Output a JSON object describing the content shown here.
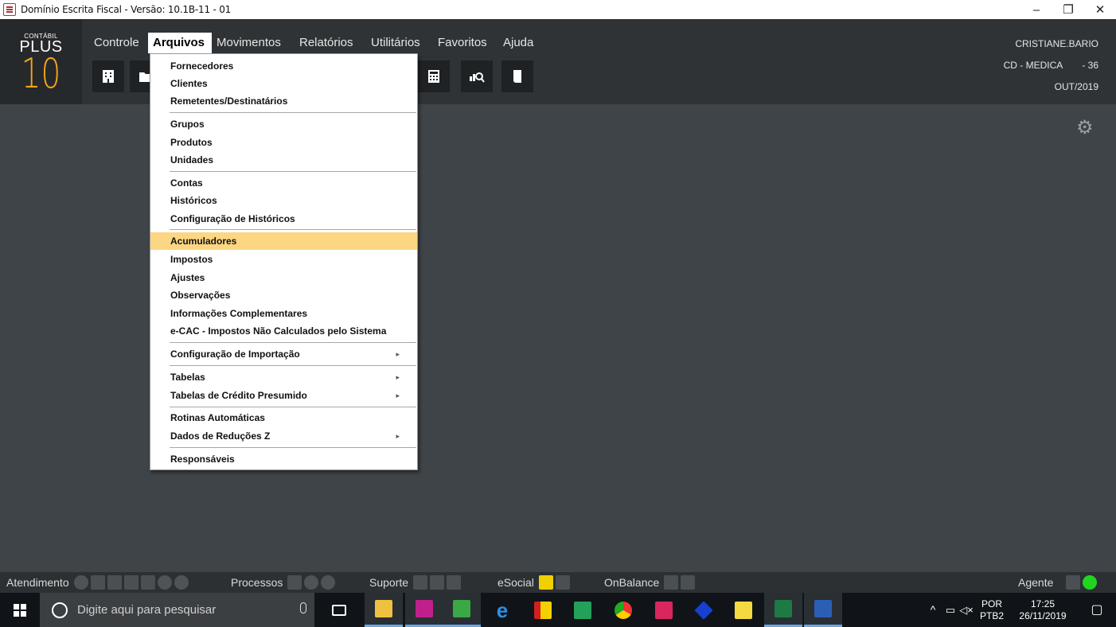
{
  "window": {
    "title": "Domínio Escrita Fiscal  - Versão: 10.1B-11 - 01",
    "controls": [
      "–",
      "❐",
      "✕"
    ]
  },
  "logo": {
    "small": "CONTÁBIL",
    "plus": "PLUS",
    "ten": "10"
  },
  "menubar": [
    {
      "label": "Controle"
    },
    {
      "label": "Arquivos",
      "active": true
    },
    {
      "label": "Movimentos"
    },
    {
      "label": "Relatórios"
    },
    {
      "label": "Utilitários"
    },
    {
      "label": "Favoritos"
    },
    {
      "label": "Ajuda"
    }
  ],
  "user": {
    "name": "CRISTIANE.BARIO",
    "company": "CD - MEDICA",
    "company_code": "- 36",
    "period": "OUT/2019"
  },
  "dropdown": {
    "items": [
      {
        "label": "Fornecedores"
      },
      {
        "label": "Clientes"
      },
      {
        "label": "Remetentes/Destinatários"
      },
      {
        "label": "Grupos"
      },
      {
        "label": "Produtos"
      },
      {
        "label": "Unidades"
      },
      {
        "label": "Contas"
      },
      {
        "label": "Históricos"
      },
      {
        "label": "Configuração de Históricos"
      },
      {
        "label": "Acumuladores",
        "highlighted": true
      },
      {
        "label": "Impostos"
      },
      {
        "label": "Ajustes"
      },
      {
        "label": "Observações"
      },
      {
        "label": "Informações Complementares"
      },
      {
        "label": "e-CAC - Impostos Não Calculados pelo Sistema"
      },
      {
        "label": "Configuração de Importação",
        "submenu": true
      },
      {
        "label": "Tabelas",
        "submenu": true
      },
      {
        "label": "Tabelas de Crédito Presumido",
        "submenu": true
      },
      {
        "label": "Rotinas Automáticas"
      },
      {
        "label": "Dados de Reduções Z",
        "submenu": true
      },
      {
        "label": "Responsáveis"
      }
    ],
    "submenu_arrow": "▸"
  },
  "status": {
    "atendimento": "Atendimento",
    "processos": "Processos",
    "suporte": "Suporte",
    "esocial": "eSocial",
    "onbalance": "OnBalance",
    "agente": "Agente"
  },
  "taskbar": {
    "search_placeholder": "Digite aqui para pesquisar",
    "lang_top": "POR",
    "lang_bottom": "PTB2",
    "time": "17:25",
    "date": "26/11/2019"
  },
  "colors": {
    "background": "#3f4448",
    "header": "#2f3336",
    "highlight": "#fcd682",
    "logo_accent": "#f2a51a"
  }
}
